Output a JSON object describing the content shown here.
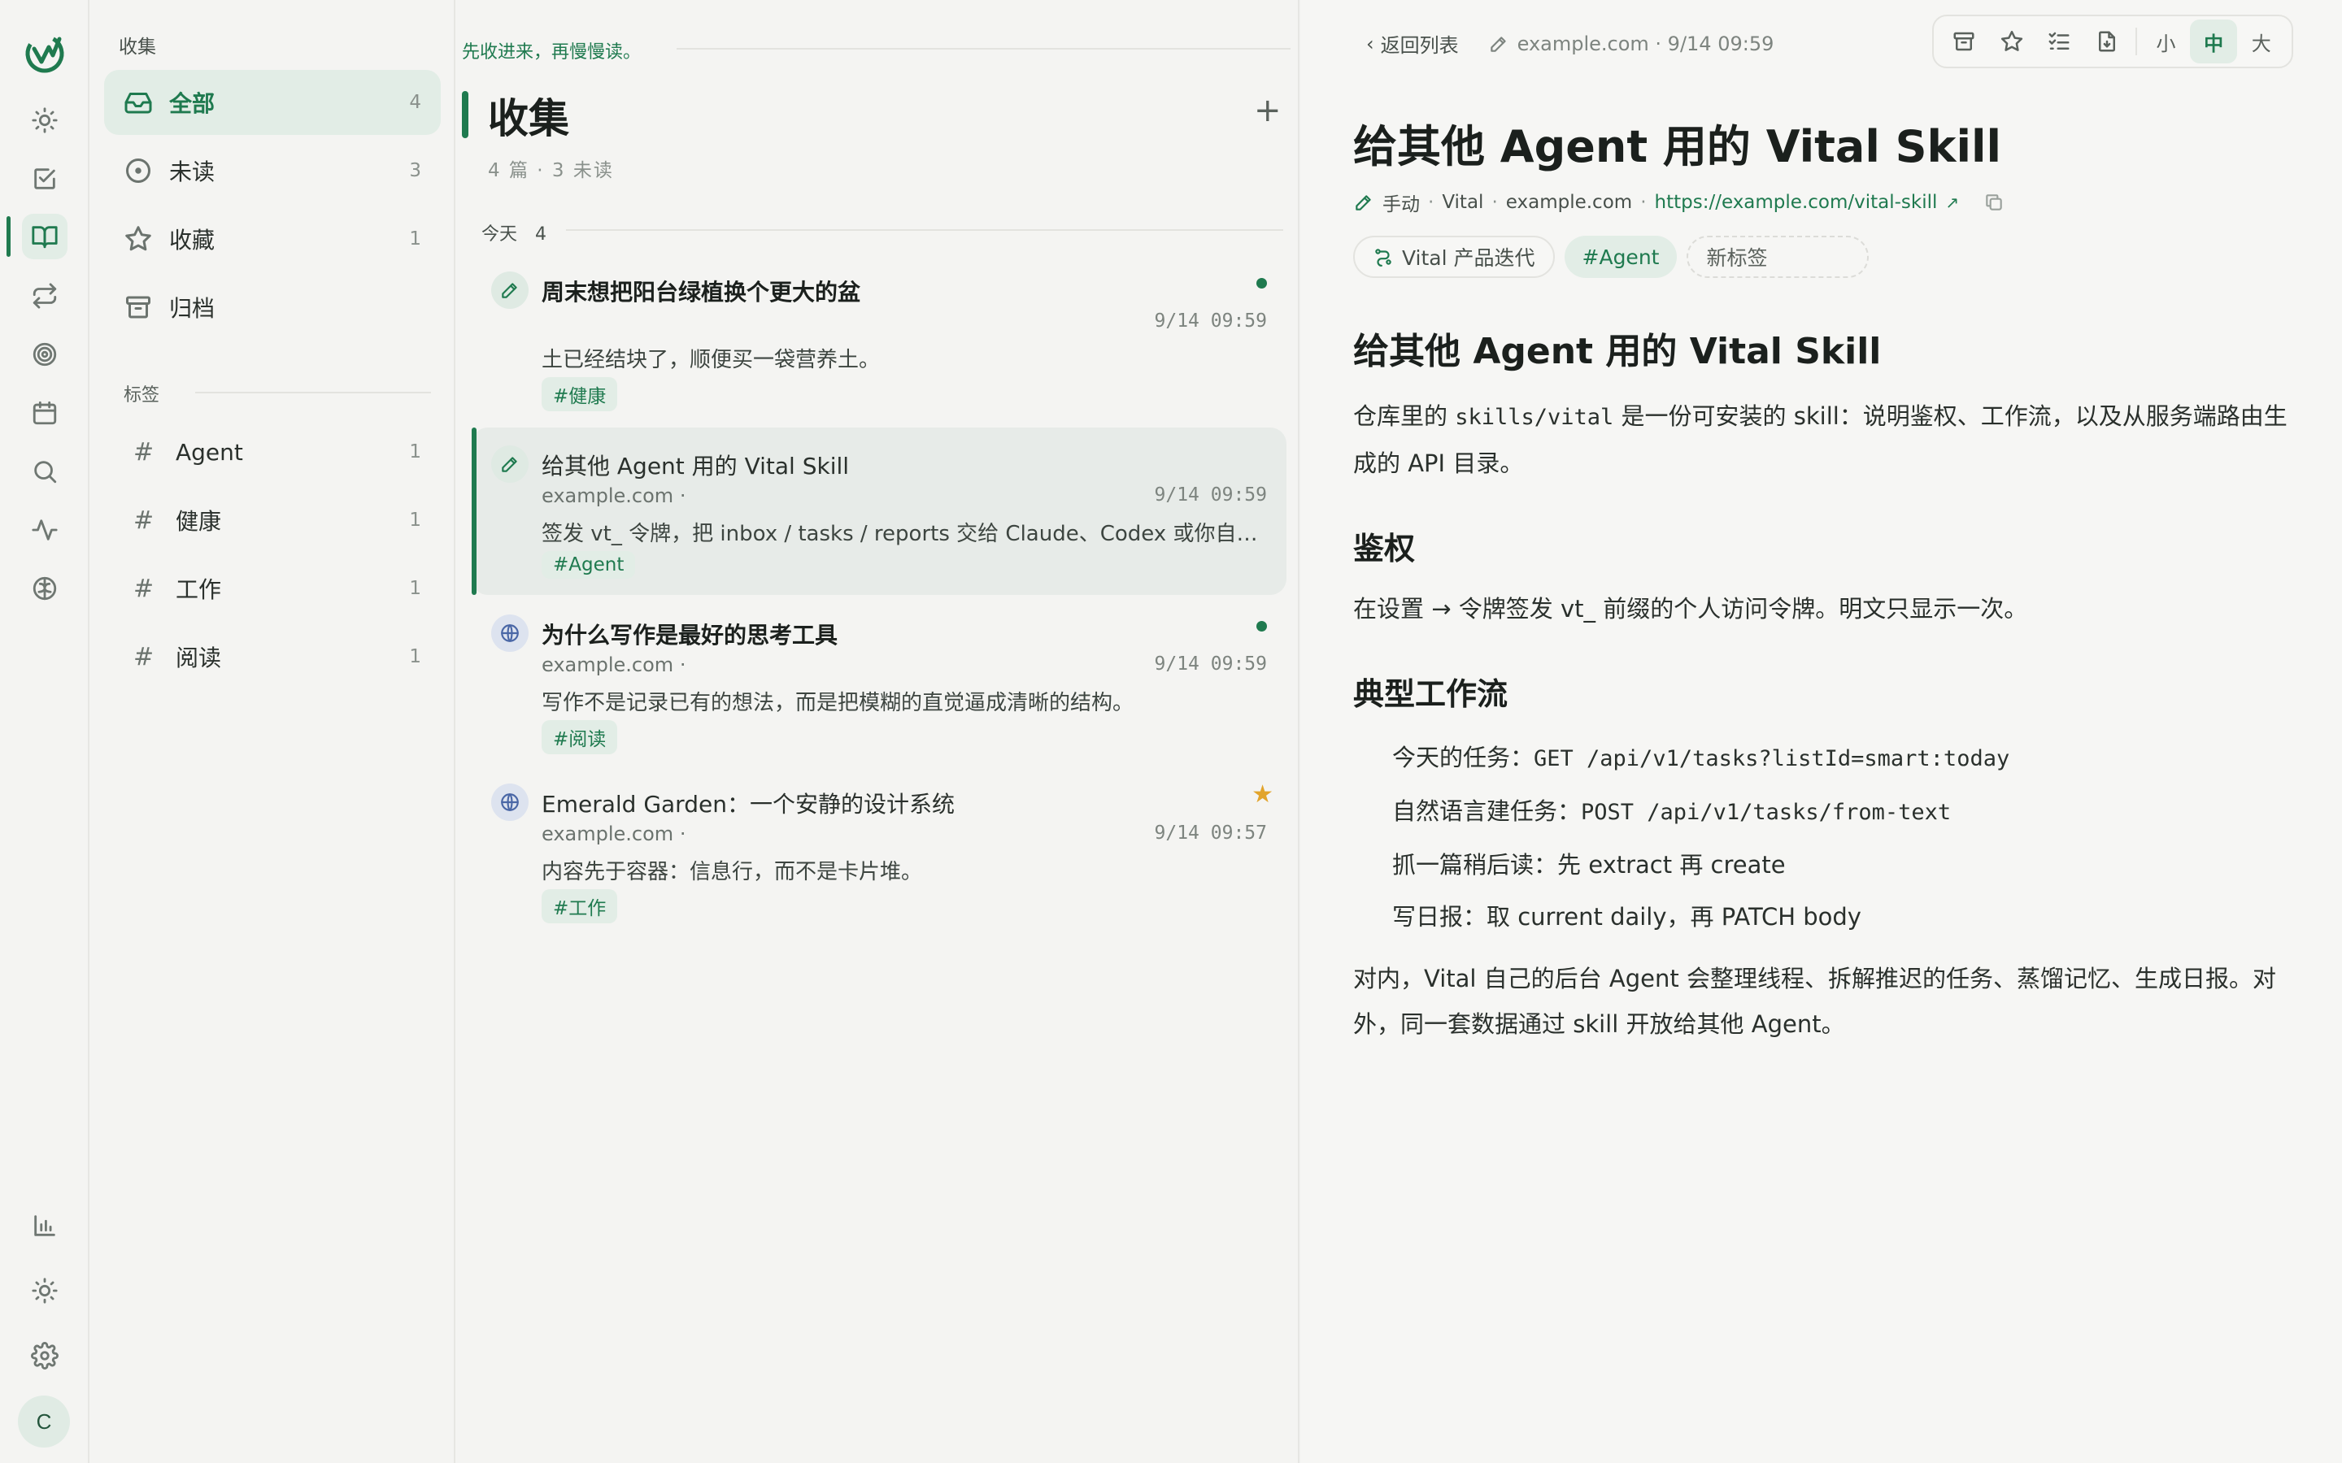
{
  "rail": {
    "avatar_letter": "C",
    "icons": [
      "logo",
      "sun-icon",
      "checkbox-icon",
      "book-icon",
      "repeat-icon",
      "target-icon",
      "calendar-icon",
      "search-icon",
      "pulse-icon",
      "brain-icon",
      "bar-chart-icon",
      "brightness-icon",
      "gear-icon"
    ],
    "accent": "#1f7a4f"
  },
  "sidebar": {
    "title": "收集",
    "items": [
      {
        "label": "全部",
        "count": "4",
        "icon": "inbox-icon"
      },
      {
        "label": "未读",
        "count": "3",
        "icon": "circle-dot-icon"
      },
      {
        "label": "收藏",
        "count": "1",
        "icon": "star-icon"
      },
      {
        "label": "归档",
        "count": "",
        "icon": "archive-icon"
      }
    ],
    "tags_heading": "标签",
    "tags": [
      {
        "label": "Agent",
        "count": "1"
      },
      {
        "label": "健康",
        "count": "1"
      },
      {
        "label": "工作",
        "count": "1"
      },
      {
        "label": "阅读",
        "count": "1"
      }
    ]
  },
  "list": {
    "slogan": "先收进来，再慢慢读。",
    "title": "收集",
    "add_label": "+",
    "meta": "4 篇 · 3 未读",
    "group_label": "今天",
    "group_count": "4",
    "cards": [
      {
        "title": "周末想把阳台绿植换个更大的盆",
        "source": "",
        "time": "9/14 09:59",
        "summary": "土已经结块了，顺便买一袋营养土。",
        "tag": "#健康",
        "kind": "note",
        "unread": true,
        "starred": false
      },
      {
        "title": "给其他 Agent 用的 Vital Skill",
        "source": "example.com ·",
        "time": "9/14 09:59",
        "summary": "签发 vt_ 令牌，把 inbox / tasks / reports 交给 Claude、Codex 或你自己的 Agent。",
        "tag": "#Agent",
        "kind": "note",
        "unread": false,
        "starred": false
      },
      {
        "title": "为什么写作是最好的思考工具",
        "source": "example.com ·",
        "time": "9/14 09:59",
        "summary": "写作不是记录已有的想法，而是把模糊的直觉逼成清晰的结构。",
        "tag": "#阅读",
        "kind": "web",
        "unread": true,
        "starred": false
      },
      {
        "title": "Emerald Garden：一个安静的设计系统",
        "source": "example.com ·",
        "time": "9/14 09:57",
        "summary": "内容先于容器：信息行，而不是卡片堆。",
        "tag": "#工作",
        "kind": "web",
        "unread": false,
        "starred": true
      }
    ]
  },
  "reader": {
    "back_label": "返回列表",
    "crumb_meta": "example.com · 9/14 09:59",
    "toolbar": {
      "icons": [
        "archive-icon",
        "star-icon",
        "checklist-icon",
        "file-export-icon"
      ],
      "sizes": [
        "小",
        "中",
        "大"
      ],
      "active_size": "中"
    },
    "title": "给其他 Agent 用的 Vital Skill",
    "meta": {
      "mode": "手动",
      "app": "Vital",
      "domain": "example.com",
      "url": "https://example.com/vital-skill"
    },
    "chips": {
      "list": "Vital 产品迭代",
      "tag": "#Agent",
      "new_tag": "新标签"
    },
    "body": {
      "h1": "给其他 Agent 用的 Vital Skill",
      "p1_a": "仓库里的 ",
      "p1_code": "skills/vital",
      "p1_b": " 是一份可安装的 skill：说明鉴权、工作流，以及从服务端路由生成的 API 目录。",
      "h2_auth": "鉴权",
      "p2": "在设置 → 令牌签发 vt_ 前缀的个人访问令牌。明文只显示一次。",
      "h2_flow": "典型工作流",
      "flow": [
        {
          "label": "今天的任务：",
          "code": "GET /api/v1/tasks?listId=smart:today",
          "text": ""
        },
        {
          "label": "自然语言建任务：",
          "code": "POST /api/v1/tasks/from-text",
          "text": ""
        },
        {
          "label": "抓一篇稍后读：",
          "code": "",
          "text": "先 extract 再 create"
        },
        {
          "label": "写日报：",
          "code": "",
          "text": "取 current daily，再 PATCH body"
        }
      ],
      "p3": "对内，Vital 自己的后台 Agent 会整理线程、拆解推迟的任务、蒸馏记忆、生成日报。对外，同一套数据通过 skill 开放给其他 Agent。"
    }
  }
}
